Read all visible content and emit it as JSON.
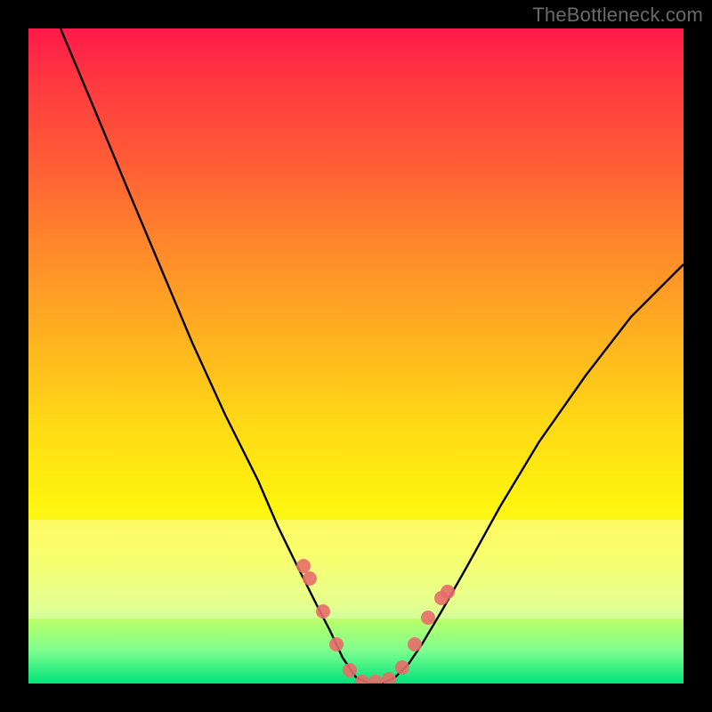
{
  "watermark": "TheBottleneck.com",
  "colors": {
    "frame": "#000000",
    "curve": "#000000",
    "marker": "#e86d6a",
    "gradient_top": "#ff1a4b",
    "gradient_mid": "#ffe012",
    "gradient_bottom": "#00e27a"
  },
  "chart_data": {
    "type": "line",
    "title": "",
    "xlabel": "",
    "ylabel": "",
    "xlim": [
      0,
      100
    ],
    "ylim": [
      0,
      100
    ],
    "grid": false,
    "series": [
      {
        "name": "bottleneck-curve",
        "x": [
          5,
          10,
          15,
          20,
          25,
          30,
          35,
          38,
          41,
          44,
          46,
          48,
          50,
          52,
          54,
          56,
          58,
          60,
          63,
          67,
          72,
          78,
          85,
          92,
          100
        ],
        "y": [
          100,
          88,
          76,
          64,
          52,
          41,
          31,
          24,
          18,
          12,
          8,
          4,
          1,
          0,
          0,
          1,
          3,
          6,
          11,
          18,
          27,
          37,
          47,
          56,
          64
        ]
      }
    ],
    "markers": {
      "name": "highlight-dots",
      "x": [
        42,
        43,
        45,
        47,
        49,
        51,
        53,
        55,
        57,
        59,
        61,
        63,
        64
      ],
      "y": [
        18,
        16,
        11,
        6,
        2,
        0,
        0,
        0.5,
        2.5,
        6,
        10,
        13,
        14
      ]
    },
    "pale_band_y": [
      10,
      25
    ]
  }
}
